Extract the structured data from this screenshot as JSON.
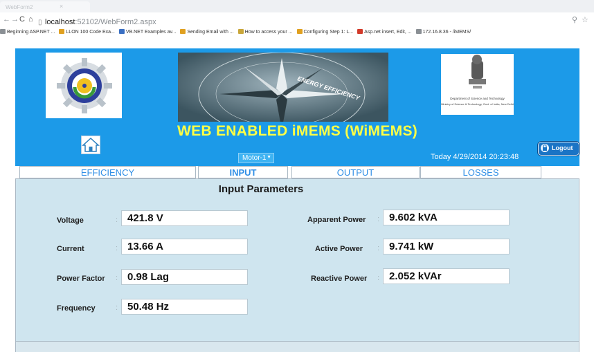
{
  "browser": {
    "tab_title": "WebForm2",
    "url_host": "localhost",
    "url_rest": ":52102/WebForm2.aspx",
    "bookmarks": [
      {
        "label": "Beginning ASP.NET ...",
        "color": "#8a8f94"
      },
      {
        "label": "LLON 100 Code Exa...",
        "color": "#e0a020"
      },
      {
        "label": "VB.NET Examples av...",
        "color": "#3a6fc2"
      },
      {
        "label": "Sending Email with ...",
        "color": "#e0a020"
      },
      {
        "label": "How to access your ...",
        "color": "#c9a63a"
      },
      {
        "label": "Configuring Step 1: L...",
        "color": "#e0a020"
      },
      {
        "label": "Asp.net insert, Edit, ...",
        "color": "#d23a2a"
      },
      {
        "label": "172.16.8.36 - /iMEMS/",
        "color": "#8a8f94"
      }
    ]
  },
  "header": {
    "title": "WEB ENABLED iMEMS (WiMEMS)",
    "energy_text": "ENERGY EFFICIENCY",
    "dst_line1": "Department of Science and Technology",
    "dst_line2": "Ministry of Science & Technology, Govt. of India, New Delhi",
    "motor_selected": "Motor-1",
    "today": "Today 4/29/2014 20:23:48",
    "logout_label": "Logout"
  },
  "tabs": [
    {
      "label": "EFFICIENCY"
    },
    {
      "label": "INPUT"
    },
    {
      "label": "OUTPUT"
    },
    {
      "label": "LOSSES"
    }
  ],
  "panel": {
    "title": "Input Parameters",
    "left": [
      {
        "label": "Voltage",
        "value": "421.8 V"
      },
      {
        "label": "Current",
        "value": "13.66 A"
      },
      {
        "label": "Power Factor",
        "value": "0.98 Lag"
      },
      {
        "label": "Frequency",
        "value": "50.48 Hz"
      }
    ],
    "right": [
      {
        "label": "Apparent Power",
        "value": "9.602 kVA"
      },
      {
        "label": "Active Power",
        "value": "9.741 kW"
      },
      {
        "label": "Reactive Power",
        "value": "2.052 kVAr"
      }
    ]
  },
  "colors": {
    "banner": "#1c9ae8",
    "title": "#ffff44",
    "tab_text": "#2f8ee6",
    "panel": "#cfe5ef"
  }
}
